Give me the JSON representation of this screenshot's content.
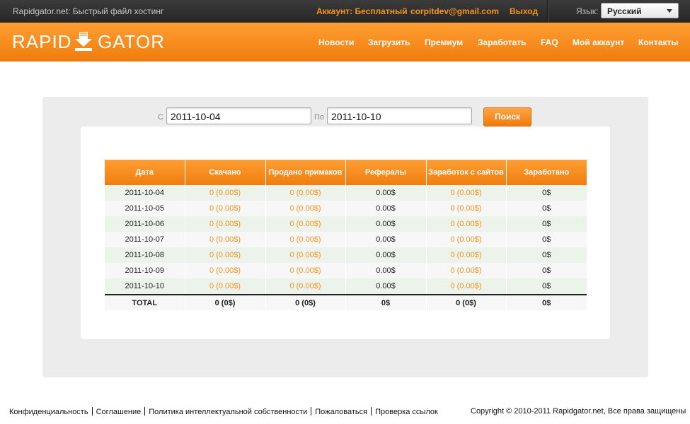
{
  "topbar": {
    "site_title": "Rapidgator.net: Быстрый файл хостинг",
    "account": "Аккаунт: Бесплатный",
    "email": "corpitdev@gmail.com",
    "logout": "Выход",
    "language_label": "Язык:",
    "language_value": "Русский"
  },
  "header": {
    "logo_part1": "RAPID",
    "logo_part2": "GATOR",
    "nav": [
      "Новости",
      "Загрузить",
      "Премиум",
      "Заработать",
      "FAQ",
      "Мой аккаунт",
      "Контакты"
    ]
  },
  "filter": {
    "from_label": "С",
    "from_value": "2011-10-04",
    "to_label": "По",
    "to_value": "2011-10-10",
    "search_button": "Поиск"
  },
  "table": {
    "headers": [
      "Дата",
      "Скачано",
      "Продано примаков",
      "Рефералы",
      "Заработок с сайтов",
      "Заработано"
    ],
    "rows": [
      [
        "2011-10-04",
        "0 (0.00$)",
        "0 (0.00$)",
        "0.00$",
        "0 (0.00$)",
        "0$"
      ],
      [
        "2011-10-05",
        "0 (0.00$)",
        "0 (0.00$)",
        "0.00$",
        "0 (0.00$)",
        "0$"
      ],
      [
        "2011-10-06",
        "0 (0.00$)",
        "0 (0.00$)",
        "0.00$",
        "0 (0.00$)",
        "0$"
      ],
      [
        "2011-10-07",
        "0 (0.00$)",
        "0 (0.00$)",
        "0.00$",
        "0 (0.00$)",
        "0$"
      ],
      [
        "2011-10-08",
        "0 (0.00$)",
        "0 (0.00$)",
        "0.00$",
        "0 (0.00$)",
        "0$"
      ],
      [
        "2011-10-09",
        "0 (0.00$)",
        "0 (0.00$)",
        "0.00$",
        "0 (0.00$)",
        "0$"
      ],
      [
        "2011-10-10",
        "0 (0.00$)",
        "0 (0.00$)",
        "0.00$",
        "0 (0.00$)",
        "0$"
      ]
    ],
    "total": [
      "TOTAL",
      "0 (0$)",
      "0 (0$)",
      "0$",
      "0 (0$)",
      "0$"
    ]
  },
  "footer": {
    "links": [
      "Конфиденциальность",
      "Соглашение",
      "Политика интеллектуальной собственности",
      "Пожаловаться",
      "Проверка ссылок"
    ],
    "copyright": "Copyright © 2010-2011 Rapidgator.net, Все права защищены"
  },
  "colors": {
    "accent_orange": "#f7931e",
    "header_orange": "#f07d0e",
    "topbar_dark": "#2e2e2e",
    "row_green": "#ebf3ea"
  },
  "icons": {
    "logo_mark": "download-arrow-icon",
    "language_dropdown": "chevron-down-icon"
  }
}
